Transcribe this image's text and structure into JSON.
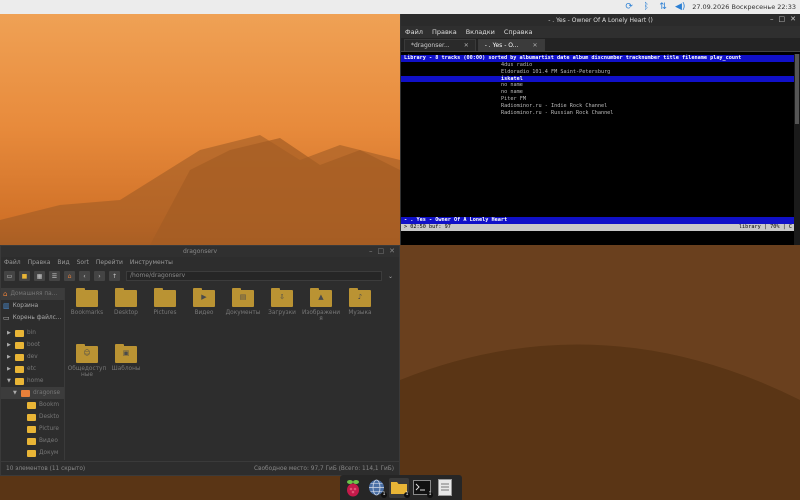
{
  "panel": {
    "datetime": "27.09.2026 Воскресенье 22:33"
  },
  "terminal": {
    "title": "- . Yes - Owner Of A Lonely Heart ()",
    "menu": [
      "Файл",
      "Правка",
      "Вкладки",
      "Справка"
    ],
    "tabs": [
      {
        "label": "*dragonser..."
      },
      {
        "label": "- . Yes - O..."
      }
    ],
    "library_header": "Library - 8 tracks (00:00) sorted by albumartist date album discnumber tracknumber title filename play_count",
    "tracks": [
      "4dus radio",
      "Eldoradio 101.4 FM Saint-Petersburg",
      "iskatel",
      "no name",
      "no name",
      "Piter FM",
      "Radiominor.ru - Indie Rock Channel",
      "Radiominor.ru - Russian Rock Channel"
    ],
    "selected_index": 2,
    "now_playing": "- . Yes - Owner Of A Lonely Heart",
    "status_left": "> 02:50 buf: 97",
    "status_right": "library | 70% | C"
  },
  "filemanager": {
    "title": "dragonserv",
    "menu": [
      "Файл",
      "Правка",
      "Вид",
      "Sort",
      "Перейти",
      "Инструменты"
    ],
    "path": "/home/dragonserv",
    "places": [
      {
        "label": "Домашняя па..."
      },
      {
        "label": "Корзина"
      },
      {
        "label": "Корень файлс..."
      }
    ],
    "tree": [
      {
        "label": "bin",
        "indent": 1,
        "arrow": "▶"
      },
      {
        "label": "boot",
        "indent": 1,
        "arrow": "▶"
      },
      {
        "label": "dev",
        "indent": 1,
        "arrow": "▶"
      },
      {
        "label": "etc",
        "indent": 1,
        "arrow": "▶"
      },
      {
        "label": "home",
        "indent": 1,
        "arrow": "▼"
      },
      {
        "label": "dragonse",
        "indent": 2,
        "arrow": "▼"
      },
      {
        "label": "Bookm",
        "indent": 3,
        "arrow": ""
      },
      {
        "label": "Deskto",
        "indent": 3,
        "arrow": ""
      },
      {
        "label": "Picture",
        "indent": 3,
        "arrow": ""
      },
      {
        "label": "Видео",
        "indent": 3,
        "arrow": ""
      },
      {
        "label": "Докум",
        "indent": 3,
        "arrow": ""
      }
    ],
    "items": [
      {
        "label": "Bookmarks",
        "glyph": ""
      },
      {
        "label": "Desktop",
        "glyph": ""
      },
      {
        "label": "Pictures",
        "glyph": ""
      },
      {
        "label": "Видео",
        "glyph": "▶"
      },
      {
        "label": "Документы",
        "glyph": "▤"
      },
      {
        "label": "Загрузки",
        "glyph": "⇩"
      },
      {
        "label": "Изображения",
        "glyph": "▲"
      },
      {
        "label": "Музыка",
        "glyph": "♪"
      },
      {
        "label": "Общедоступные",
        "glyph": "☺"
      },
      {
        "label": "Шаблоны",
        "glyph": "▣"
      }
    ],
    "status_left": "10 элементов (11 скрыто)",
    "status_right": "Свободное место: 97,7 ГиБ (Всего: 114,1 ГиБ)"
  },
  "taskbar": {
    "apps": [
      {
        "name": "raspberry-menu-icon",
        "badge": ""
      },
      {
        "name": "browser-globe-icon",
        "badge": "1"
      },
      {
        "name": "file-manager-icon",
        "badge": "1"
      },
      {
        "name": "terminal-icon",
        "badge": "1"
      },
      {
        "name": "text-editor-icon",
        "badge": ""
      }
    ]
  }
}
